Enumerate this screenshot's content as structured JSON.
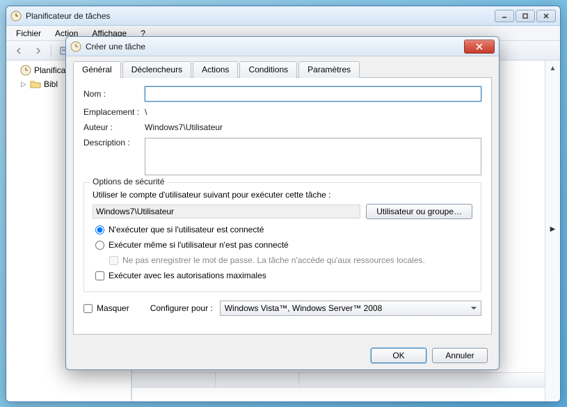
{
  "mainWindow": {
    "title": "Planificateur de tâches",
    "menu": {
      "file": "Fichier",
      "action": "Action",
      "view": "Affichage",
      "help": "?"
    },
    "tree": {
      "root": "Planificateur de tâches (Local)",
      "child": "Bibliothèque du Planificateur de tâches",
      "child_short": "Bibl"
    }
  },
  "dialog": {
    "title": "Créer une tâche",
    "tabs": {
      "general": "Général",
      "triggers": "Déclencheurs",
      "actions": "Actions",
      "conditions": "Conditions",
      "settings": "Paramètres"
    },
    "general": {
      "name_label": "Nom :",
      "name_value": "",
      "location_label": "Emplacement :",
      "location_value": "\\",
      "author_label": "Auteur :",
      "author_value": "Windows7\\Utilisateur",
      "description_label": "Description :",
      "description_value": ""
    },
    "security": {
      "legend": "Options de sécurité",
      "account_label": "Utiliser le compte d'utilisateur suivant pour exécuter cette tâche :",
      "account_value": "Windows7\\Utilisateur",
      "change_user_btn": "Utilisateur ou groupe…",
      "radio_logged": "N'exécuter que si l'utilisateur est connecté",
      "radio_notlogged": "Exécuter même si l'utilisateur n'est pas connecté",
      "no_password": "Ne pas enregistrer le mot de passe. La tâche n'accède qu'aux ressources locales.",
      "highest_priv": "Exécuter avec les autorisations maximales"
    },
    "bottom": {
      "hidden": "Masquer",
      "configure_for": "Configurer pour :",
      "configure_value": "Windows Vista™, Windows Server™ 2008"
    },
    "buttons": {
      "ok": "OK",
      "cancel": "Annuler"
    }
  }
}
